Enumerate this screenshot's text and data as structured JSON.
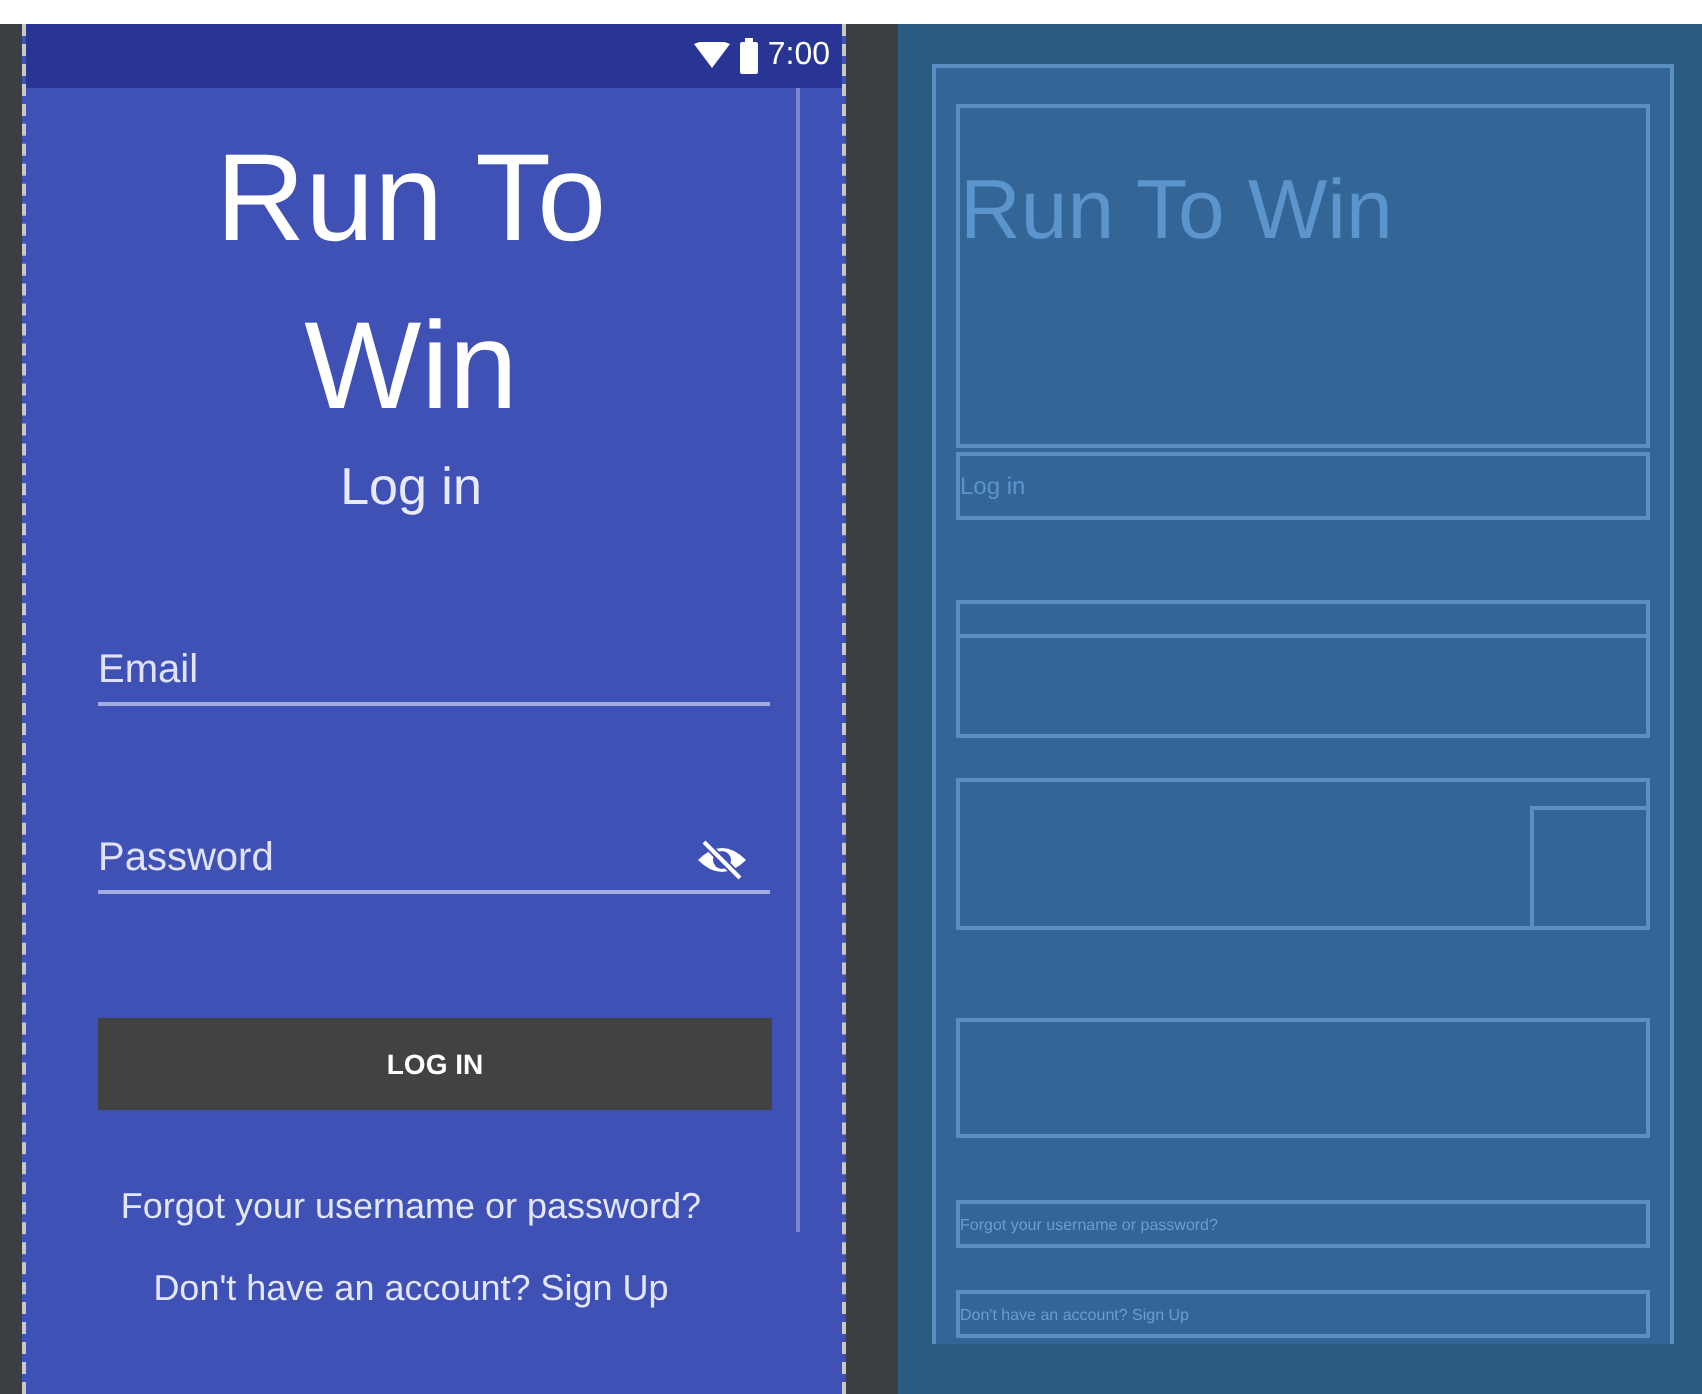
{
  "status_bar": {
    "time": "7:00"
  },
  "design": {
    "title": "Run To Win",
    "subtitle": "Log in",
    "fields": [
      {
        "placeholder": "Email",
        "kind": "text"
      },
      {
        "placeholder": "Password",
        "kind": "password"
      }
    ],
    "login_button": "LOG IN",
    "forgot_link": "Forgot your username or password?",
    "signup_text": "Don't have an account? Sign Up"
  },
  "blueprint": {
    "title": "Run To Win",
    "subtitle": "Log in",
    "forgot_link": "Forgot your username or password?",
    "signup_text": "Don't have an account? Sign Up"
  }
}
